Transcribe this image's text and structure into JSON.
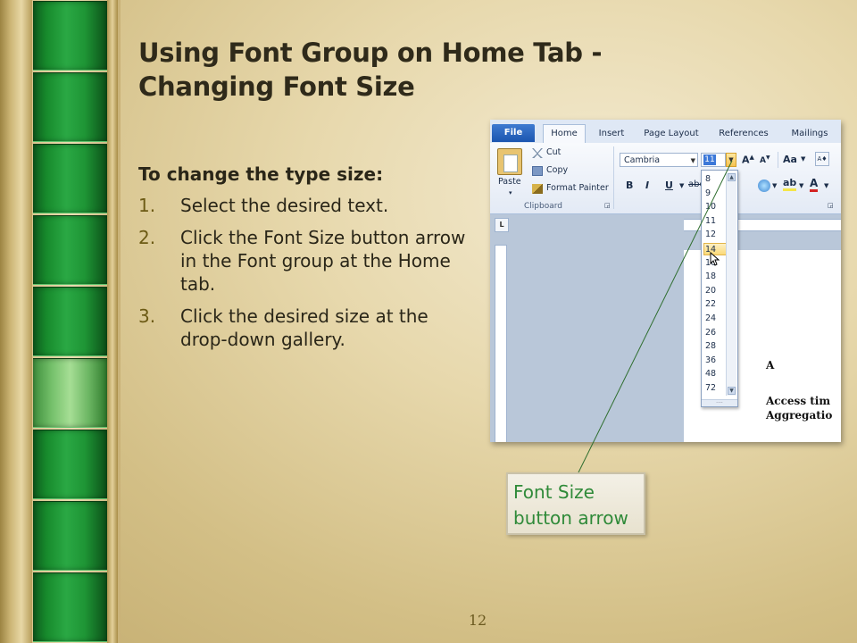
{
  "slide": {
    "title_line1": "Using Font Group on Home Tab  -",
    "title_line2": "Changing Font Size",
    "subhead": "To change the type size:",
    "steps": [
      {
        "num": "1.",
        "text": "Select the desired text."
      },
      {
        "num": "2.",
        "text": "Click the Font Size button arrow in the Font group at the Home tab."
      },
      {
        "num": "3.",
        "text": "Click the desired size at the drop-down gallery."
      }
    ],
    "callout": "Font Size button arrow",
    "page_number": "12"
  },
  "screenshot": {
    "tabs": [
      "File",
      "Home",
      "Insert",
      "Page Layout",
      "References",
      "Mailings"
    ],
    "clipboard": {
      "paste": "Paste",
      "cut": "Cut",
      "copy": "Copy",
      "format_painter": "Format Painter",
      "group_label": "Clipboard"
    },
    "font": {
      "name": "Cambria",
      "size": "11",
      "grow_label": "A",
      "shrink_label": "A",
      "change_case": "Aa",
      "bold": "B",
      "italic": "I",
      "underline": "U"
    },
    "size_options": [
      "8",
      "9",
      "10",
      "11",
      "12",
      "14",
      "16",
      "18",
      "20",
      "22",
      "24",
      "26",
      "28",
      "36",
      "48",
      "72"
    ],
    "hover_size": "14",
    "ruler_corner": "L",
    "doc_text": [
      "A",
      "Access tim",
      "Aggregatio"
    ]
  },
  "colors": {
    "green_tile": "#1e9535",
    "title_text": "#2f2a1a",
    "callout_text": "#2f8a39",
    "number_color": "#6c5a14"
  }
}
